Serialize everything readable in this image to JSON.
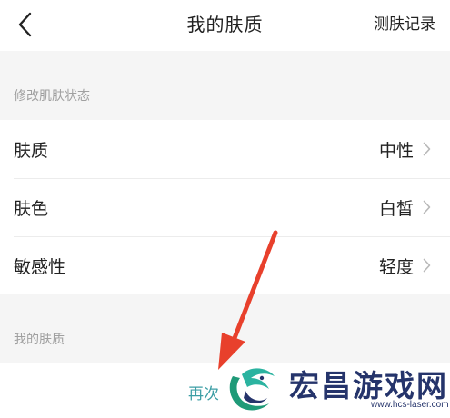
{
  "header": {
    "back_icon": "chevron-left-icon",
    "title": "我的肤质",
    "records_link": "测肤记录"
  },
  "modify_section": {
    "label": "修改肌肤状态",
    "rows": [
      {
        "label": "肤质",
        "value": "中性",
        "icon": "chevron-right-icon"
      },
      {
        "label": "肤色",
        "value": "白皙",
        "icon": "chevron-right-icon"
      },
      {
        "label": "敏感性",
        "value": "轻度",
        "icon": "chevron-right-icon"
      }
    ]
  },
  "my_skin_section": {
    "label": "我的肤质"
  },
  "bottom": {
    "retest_text": "再次"
  },
  "annotation": {
    "arrow_color": "#e8402c"
  },
  "watermark": {
    "title": "宏昌游戏网",
    "url": "www.hcs-laser.com",
    "color": "#25346b"
  }
}
